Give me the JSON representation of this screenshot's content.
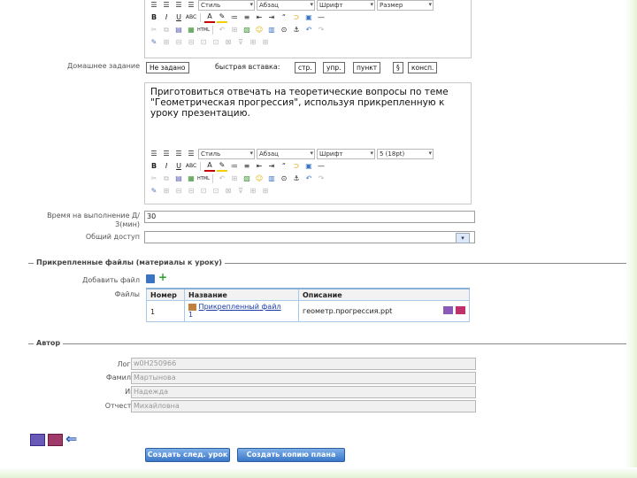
{
  "toolbar": {
    "style": "Стиль",
    "paragraph": "Абзац",
    "font": "Шрифт",
    "size": "Размер",
    "size2": "5 (18pt)"
  },
  "homework": {
    "label": "Домашнее задание",
    "value": "Не задано",
    "quick_label": "быстрая вставка:",
    "quick_buttons": [
      "стр.",
      "упр.",
      "пункт",
      "§",
      "консп."
    ]
  },
  "editor_text": "Приготовиться отвечать на теоретические вопросы по теме \"Геометрическая прогрессия\", используя прикрепленную к уроку презентацию.",
  "time": {
    "label": "Время на выполнение Д/З(мин)",
    "value": "30"
  },
  "access": {
    "label": "Общий доступ",
    "value": ""
  },
  "attached": {
    "title": "Прикрепленные файлы (материалы к уроку)",
    "add_label": "Добавить файл",
    "files_label": "Файлы",
    "columns": [
      "Номер",
      "Название",
      "Описание"
    ],
    "rows": [
      {
        "num": "1",
        "name": "Прикрепленный файл",
        "name_num": "1",
        "desc": "геометр.прогрессия.ppt"
      }
    ]
  },
  "author": {
    "title": "Автор",
    "fields": [
      {
        "label": "Логин",
        "value": "w0H250966"
      },
      {
        "label": "Фамилия",
        "value": "Мартынова"
      },
      {
        "label": "Имя",
        "value": "Надежда"
      },
      {
        "label": "Отчество",
        "value": "Михайловна"
      }
    ]
  },
  "buttons": {
    "next": "Создать след. урок",
    "copy": "Создать копию плана"
  }
}
